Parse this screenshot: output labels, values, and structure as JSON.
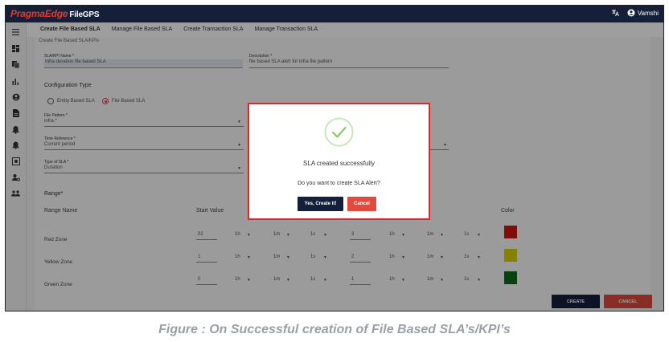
{
  "app": {
    "brand": "PragmaEdge",
    "product": "FileGPS",
    "user": "Vamshi"
  },
  "tabs": [
    {
      "label": "Create File Based SLA",
      "active": true
    },
    {
      "label": "Manage File Based SLA",
      "active": false
    },
    {
      "label": "Create Transaction SLA",
      "active": false
    },
    {
      "label": "Manage Transaction SLA",
      "active": false
    }
  ],
  "sidebar": {
    "icons": [
      "menu-icon",
      "dashboard-icon",
      "files-icon",
      "chart-icon",
      "account-icon",
      "document-icon",
      "alert-icon",
      "bell-icon",
      "settings-box-icon",
      "user-settings-icon",
      "group-icon"
    ]
  },
  "form": {
    "heading": "Create File Based SLA/KPIs",
    "name_label": "SLA/KPI Name *",
    "name_value": "Infra duration file based SLA",
    "desc_label": "Description *",
    "desc_value": "file based SLA alert for infra file pattern",
    "config_title": "Configuration Type",
    "radio_entity": "Entity Based SLA",
    "radio_file": "File Based SLA",
    "file_pattern_label": "File Pattern *",
    "file_pattern_value": "infra.*",
    "time_ref_label": "Time Reference *",
    "time_ref_value": "Current period",
    "type_label": "Type of SLA *",
    "type_value": "Duration",
    "range_title": "Range*",
    "range_name_header": "Range Name",
    "start_value_header": "Start Value",
    "color_header": "Color"
  },
  "zones": [
    {
      "name": "Red Zone",
      "start": "02",
      "h1": "1h",
      "m1": "1m",
      "s1": "1s",
      "end": "3",
      "h2": "1h",
      "m2": "1m",
      "s2": "1s",
      "color": "#d0160e"
    },
    {
      "name": "Yellow Zone",
      "start": "1",
      "h1": "1h",
      "m1": "1m",
      "s1": "1s",
      "end": "2",
      "h2": "1h",
      "m2": "1m",
      "s2": "1s",
      "color": "#d8d000"
    },
    {
      "name": "Green Zone",
      "start": "0",
      "h1": "1h",
      "m1": "1m",
      "s1": "1s",
      "end": "1",
      "h2": "1h",
      "m2": "1m",
      "s2": "1s",
      "color": "#0e6b1a"
    }
  ],
  "actions": {
    "create": "CREATE",
    "cancel": "CANCEL"
  },
  "dialog": {
    "title": "SLA created successfully",
    "question": "Do you want to create SLA Alert?",
    "yes": "Yes, Create it!",
    "no": "Cancel"
  },
  "caption": "Figure : On Successful creation of File Based SLA’s/KPI’s"
}
